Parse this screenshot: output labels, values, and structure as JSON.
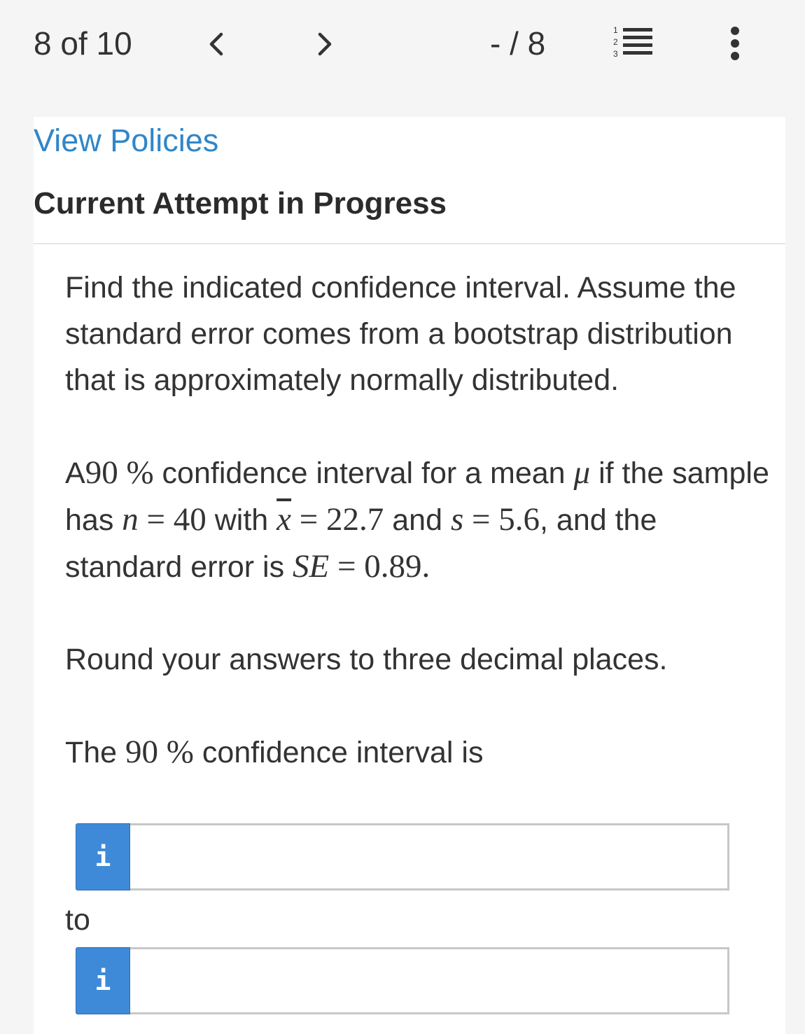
{
  "nav": {
    "counter": "8 of 10",
    "prev_symbol": "<",
    "next_symbol": ">",
    "page_indicator": "- / 8"
  },
  "header": {
    "policies_link": "View Policies",
    "attempt_heading": "Current Attempt in Progress"
  },
  "question": {
    "instruction": "Find the indicated confidence interval. Assume the standard error comes from a bootstrap distribution that is approximately normally distributed.",
    "body": {
      "t1": "A",
      "pct": "90 %",
      "t2": " confidence interval for a mean ",
      "mu": "μ",
      "t3": " if the sample has ",
      "n_var": "n",
      "eq1": " = 40",
      "t4": " with ",
      "xbar_var": "x",
      "eq2": " = 22.7",
      "t5": " and ",
      "s_var": "s",
      "eq3": " = 5.6",
      "t6": ", and the standard error is ",
      "se_var": "SE",
      "eq4": " = 0.89."
    },
    "rounding": "Round your answers to three decimal places.",
    "answer_label": {
      "t1": "The ",
      "pct": "90 %",
      "t2": " confidence interval is"
    },
    "to_label": "to",
    "info_symbol": "i",
    "lower_value": "",
    "upper_value": ""
  },
  "colors": {
    "link": "#2f86c9",
    "info_button": "#3f8ad8",
    "background": "#f5f5f5"
  },
  "icons": {
    "prev": "chevron-left-icon",
    "next": "chevron-right-icon",
    "list": "numbered-list-icon",
    "more": "more-vertical-icon"
  }
}
